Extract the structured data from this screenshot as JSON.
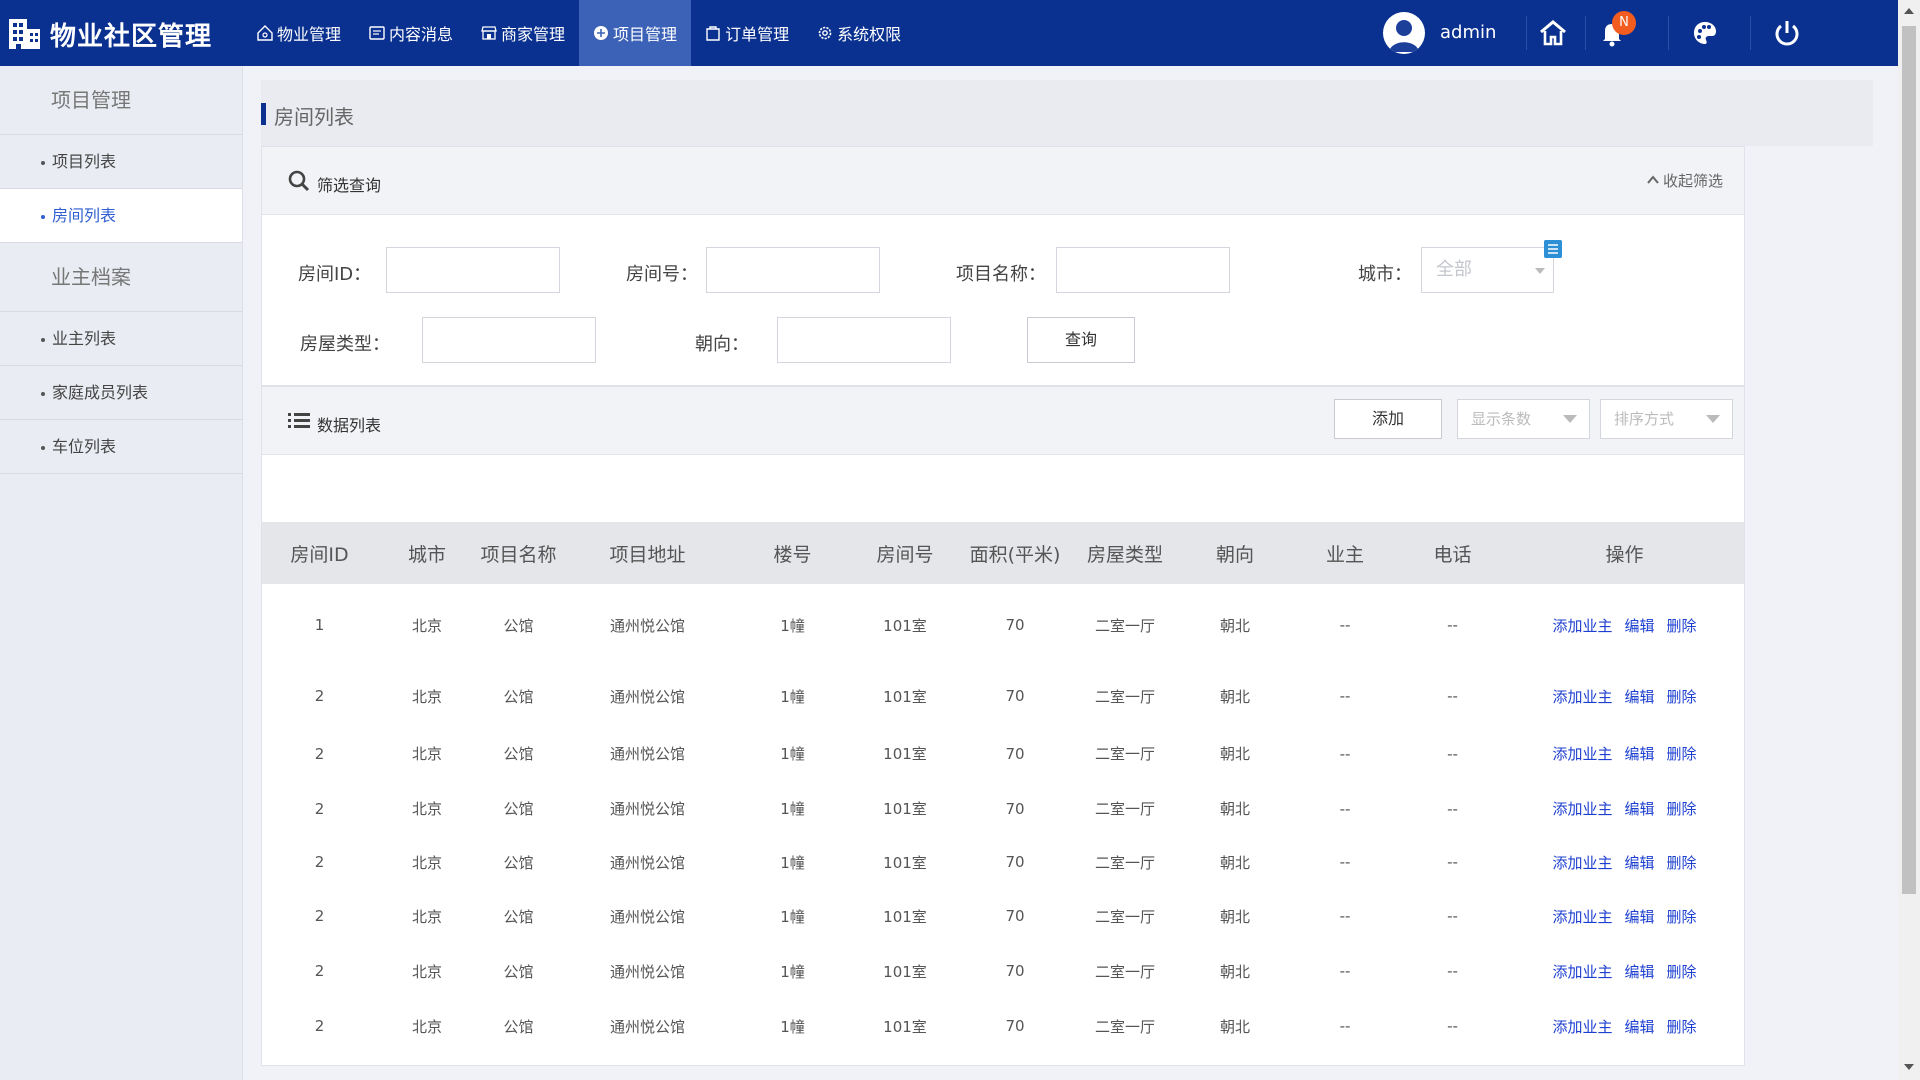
{
  "app": {
    "title": "物业社区管理"
  },
  "nav": [
    {
      "label": "物业管理",
      "icon": "home-outline-icon"
    },
    {
      "label": "内容消息",
      "icon": "message-icon"
    },
    {
      "label": "商家管理",
      "icon": "shop-icon"
    },
    {
      "label": "项目管理",
      "icon": "project-icon",
      "active": true
    },
    {
      "label": "订单管理",
      "icon": "order-bag-icon"
    },
    {
      "label": "系统权限",
      "icon": "gear-icon"
    }
  ],
  "user": {
    "name": "admin",
    "notification_badge": "N"
  },
  "sidebar": {
    "groups": [
      {
        "label": "项目管理",
        "items": [
          {
            "label": "项目列表"
          },
          {
            "label": "房间列表",
            "active": true
          }
        ]
      },
      {
        "label": "业主档案",
        "items": [
          {
            "label": "业主列表"
          },
          {
            "label": "家庭成员列表"
          },
          {
            "label": "车位列表"
          }
        ]
      }
    ]
  },
  "page": {
    "title": "房间列表"
  },
  "filter": {
    "title": "筛选查询",
    "collapse_label": "收起筛选",
    "labels": {
      "room_id": "房间ID：",
      "room_no": "房间号：",
      "project_name": "项目名称：",
      "city": "城市：",
      "house_type": "房屋类型：",
      "orientation": "朝向："
    },
    "values": {
      "room_id": "",
      "room_no": "",
      "project_name": "",
      "house_type": "",
      "orientation": ""
    },
    "city_selected": "全部",
    "query_button": "查询"
  },
  "list": {
    "title": "数据列表",
    "add_button": "添加",
    "page_size_placeholder": "显示条数",
    "sort_placeholder": "排序方式",
    "columns": [
      "房间ID",
      "城市",
      "项目名称",
      "项目地址",
      "楼号",
      "房间号",
      "面积(平米)",
      "房屋类型",
      "朝向",
      "业主",
      "电话",
      "操作"
    ],
    "actions": [
      "添加业主",
      "编辑",
      "删除"
    ],
    "rows": [
      [
        "1",
        "北京",
        "公馆",
        "通州悦公馆",
        "1幢",
        "101室",
        "70",
        "二室一厅",
        "朝北",
        "--",
        "--"
      ],
      [
        "2",
        "北京",
        "公馆",
        "通州悦公馆",
        "1幢",
        "101室",
        "70",
        "二室一厅",
        "朝北",
        "--",
        "--"
      ],
      [
        "2",
        "北京",
        "公馆",
        "通州悦公馆",
        "1幢",
        "101室",
        "70",
        "二室一厅",
        "朝北",
        "--",
        "--"
      ],
      [
        "2",
        "北京",
        "公馆",
        "通州悦公馆",
        "1幢",
        "101室",
        "70",
        "二室一厅",
        "朝北",
        "--",
        "--"
      ],
      [
        "2",
        "北京",
        "公馆",
        "通州悦公馆",
        "1幢",
        "101室",
        "70",
        "二室一厅",
        "朝北",
        "--",
        "--"
      ],
      [
        "2",
        "北京",
        "公馆",
        "通州悦公馆",
        "1幢",
        "101室",
        "70",
        "二室一厅",
        "朝北",
        "--",
        "--"
      ],
      [
        "2",
        "北京",
        "公馆",
        "通州悦公馆",
        "1幢",
        "101室",
        "70",
        "二室一厅",
        "朝北",
        "--",
        "--"
      ],
      [
        "2",
        "北京",
        "公馆",
        "通州悦公馆",
        "1幢",
        "101室",
        "70",
        "二室一厅",
        "朝北",
        "--",
        "--"
      ]
    ]
  },
  "colors": {
    "topbar": "#0b3190",
    "nav_active": "#3c62b8",
    "link": "#1c3fd0",
    "badge": "#f25c1f"
  }
}
